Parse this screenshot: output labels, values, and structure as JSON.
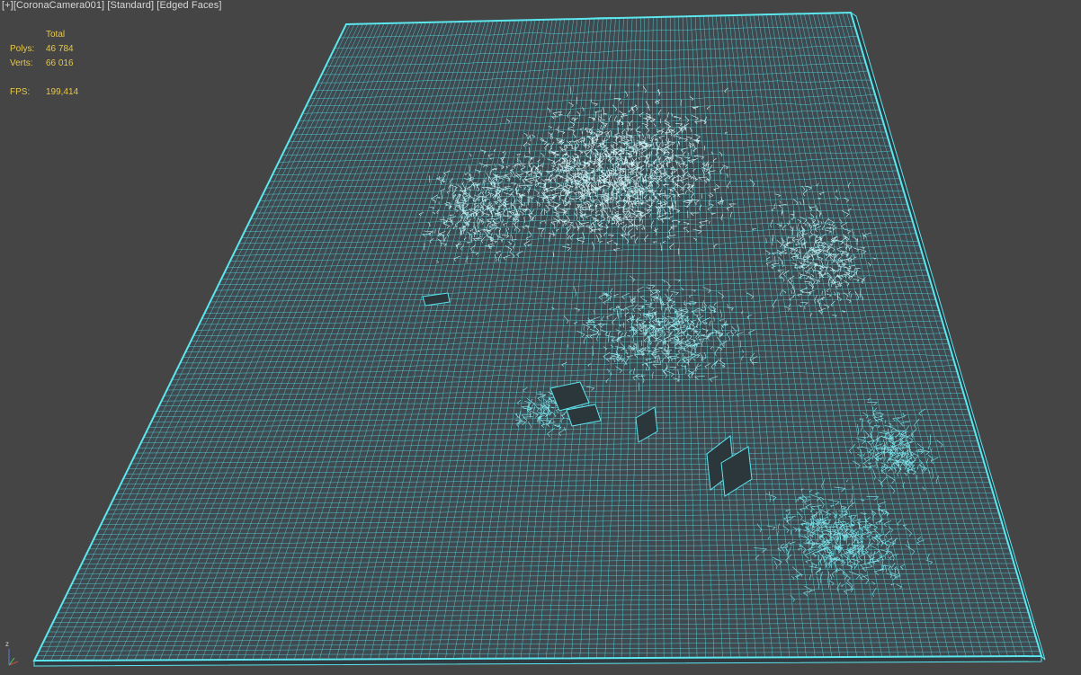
{
  "viewport": {
    "label_prefix": "[+]",
    "camera": "[CoronaCamera001]",
    "shading": "[Standard]",
    "display": "[Edged Faces]",
    "background_color": "#454545",
    "wire_color": "#5ce6ee",
    "mesh_fill": "#3e4a50"
  },
  "stats": {
    "header": "Total",
    "polys_label": "Polys:",
    "polys_value": "46 784",
    "verts_label": "Verts:",
    "verts_value": "66 016",
    "fps_label": "FPS:",
    "fps_value": "199,414",
    "text_color": "#e6c84a"
  },
  "gizmo": {
    "axis_z": "z",
    "icon": "axis-tripod-icon"
  }
}
